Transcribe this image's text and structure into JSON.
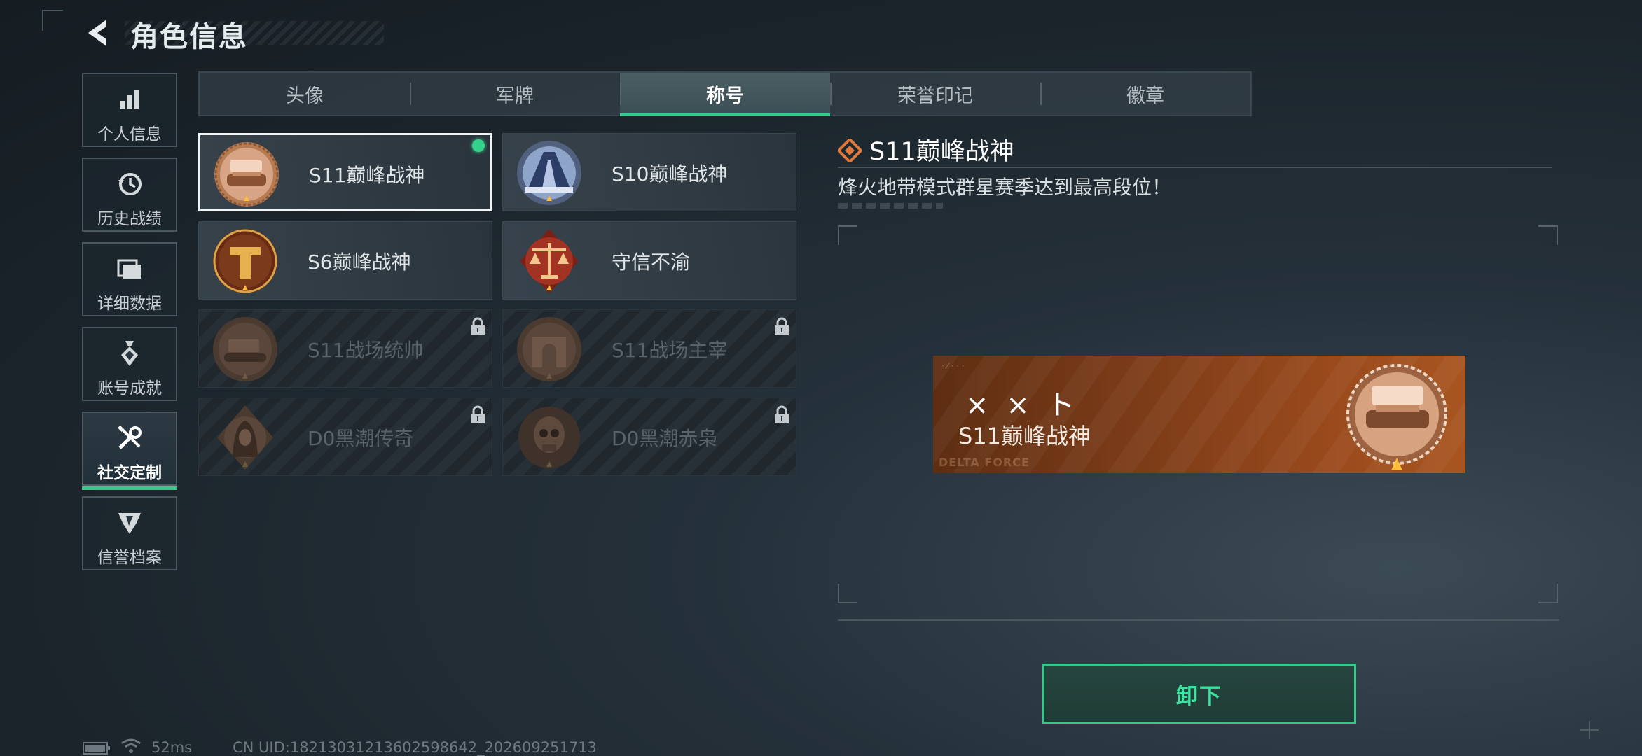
{
  "header": {
    "title": "角色信息"
  },
  "sidebar": {
    "items": [
      {
        "label": "个人信息",
        "icon": "bar-chart-icon"
      },
      {
        "label": "历史战绩",
        "icon": "history-clock-icon"
      },
      {
        "label": "详细数据",
        "icon": "folder-icon"
      },
      {
        "label": "账号成就",
        "icon": "achievement-icon"
      },
      {
        "label": "社交定制",
        "icon": "tools-icon",
        "active": true
      },
      {
        "label": "信誉档案",
        "icon": "shield-badge-icon"
      }
    ]
  },
  "tabs": [
    {
      "label": "头像"
    },
    {
      "label": "军牌"
    },
    {
      "label": "称号",
      "active": true
    },
    {
      "label": "荣誉印记"
    },
    {
      "label": "徽章"
    }
  ],
  "titles": [
    {
      "name": "S11巅峰战神",
      "equipped": true,
      "locked": false,
      "icon": "tank-emblem-icon"
    },
    {
      "name": "S10巅峰战神",
      "equipped": false,
      "locked": false,
      "icon": "tower-emblem-icon"
    },
    {
      "name": "S6巅峰战神",
      "equipped": false,
      "locked": false,
      "icon": "t-emblem-icon"
    },
    {
      "name": "守信不渝",
      "equipped": false,
      "locked": false,
      "icon": "scales-emblem-icon"
    },
    {
      "name": "S11战场统帅",
      "equipped": false,
      "locked": true,
      "icon": "armored-vehicle-emblem-icon"
    },
    {
      "name": "S11战场主宰",
      "equipped": false,
      "locked": true,
      "icon": "arch-emblem-icon"
    },
    {
      "name": "D0黑潮传奇",
      "equipped": false,
      "locked": true,
      "icon": "hooded-figure-emblem-icon"
    },
    {
      "name": "D0黑潮赤枭",
      "equipped": false,
      "locked": true,
      "icon": "skull-emblem-icon"
    }
  ],
  "detail": {
    "title": "S11巅峰战神",
    "description": "烽火地带模式群星赛季达到最高段位！",
    "preview": {
      "symbols": "× × ト",
      "name": "S11巅峰战神",
      "watermark": "DELTA FORCE"
    },
    "unequip_label": "卸下"
  },
  "status": {
    "ping": "52ms",
    "uid": "CN UID:18213031213602598642_202609251713"
  },
  "colors": {
    "accent": "#35c98c",
    "banner": "#8a4219",
    "background": "#1d262d"
  }
}
